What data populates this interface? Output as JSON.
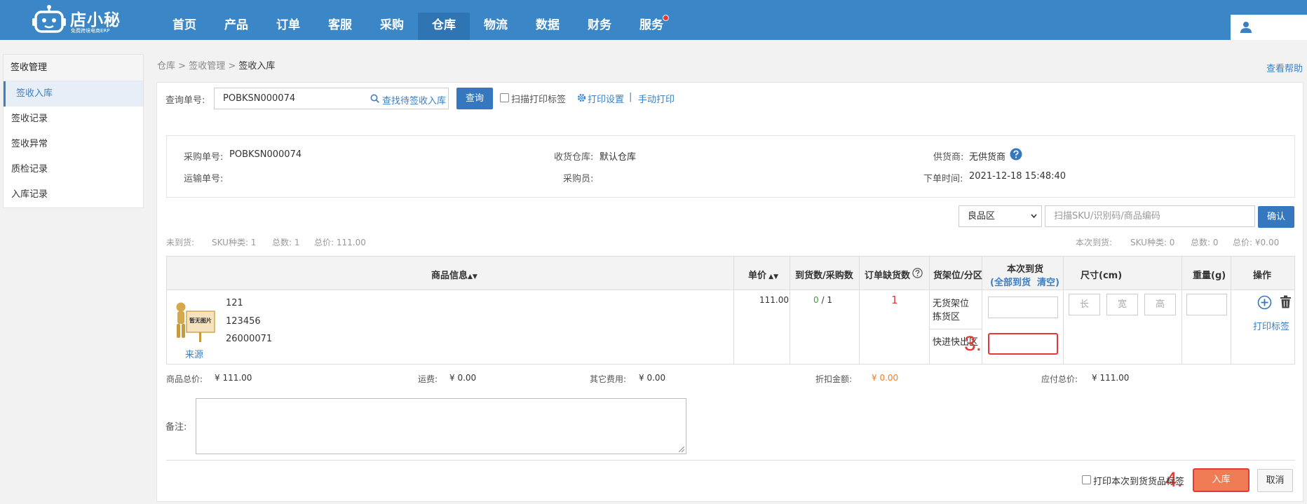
{
  "app": {
    "name": "店小秘",
    "subtitle": "免费跨境电商ERP"
  },
  "nav": [
    {
      "label": "首页"
    },
    {
      "label": "产品"
    },
    {
      "label": "订单"
    },
    {
      "label": "客服"
    },
    {
      "label": "采购"
    },
    {
      "label": "仓库"
    },
    {
      "label": "物流"
    },
    {
      "label": "数据"
    },
    {
      "label": "财务"
    },
    {
      "label": "服务"
    }
  ],
  "nav_active": "仓库",
  "sidebar": {
    "title": "签收管理",
    "items": [
      {
        "label": "签收入库"
      },
      {
        "label": "签收记录"
      },
      {
        "label": "签收异常"
      },
      {
        "label": "质检记录"
      },
      {
        "label": "入库记录"
      }
    ],
    "active": "签收入库"
  },
  "breadcrumb": {
    "p1": "仓库",
    "p2": "签收管理",
    "current": "签收入库",
    "sep": " > "
  },
  "help_link": "查看帮助",
  "query": {
    "label": "查询单号:",
    "value": "POBKSN000074",
    "find_link": "查找待签收入库",
    "search_button": "查询",
    "scan_print_label": "扫描打印标签",
    "print_settings": "打印设置",
    "divider": "|",
    "manual_print": "手动打印"
  },
  "order_info": {
    "po_label": "采购单号:",
    "po_value": "POBKSN000074",
    "warehouse_label": "收货仓库:",
    "warehouse_value": "默认仓库",
    "supplier_label": "供货商:",
    "supplier_value": "无供货商",
    "tracking_label": "运输单号:",
    "tracking_value": "",
    "buyer_label": "采购员:",
    "buyer_value": "",
    "order_time_label": "下单时间:",
    "order_time_value": "2021-12-18 15:48:40"
  },
  "zone_select": {
    "value": "良品区"
  },
  "scan": {
    "placeholder": "扫描SKU/识别码/商品编码",
    "confirm_button": "确认"
  },
  "summary_left": {
    "label": "未到货:",
    "sku": "SKU种类: 1",
    "total": "总数: 1",
    "price": "总价: 111.00"
  },
  "summary_right": {
    "label": "本次到货:",
    "sku": "SKU种类: 0",
    "total": "总数: 0",
    "price": "总价: ¥0.00"
  },
  "table": {
    "headers": {
      "product": "商品信息",
      "price": "单价",
      "arrived": "到货数/采购数",
      "shortage": "订单缺货数",
      "shelf": "货架位/分区",
      "current_arrival": "本次到货",
      "all_arrived": "全部到货",
      "clear": "清空",
      "size": "尺寸(cm)",
      "weight": "重量(g)",
      "action": "操作"
    },
    "row": {
      "no_image": "暂无图片",
      "source_link": "来源",
      "name": "121",
      "sku": "123456",
      "code": "26000071",
      "price": "111.00",
      "arrived": "0",
      "slash": " / ",
      "purchased": "1",
      "shortage": "1",
      "shelf1_line1": "无货架位",
      "shelf1_line2": "拣货区",
      "shelf2": "快进快出区",
      "len_ph": "长",
      "width_ph": "宽",
      "height_ph": "高",
      "print_label": "打印标签"
    }
  },
  "totals": {
    "goods_label": "商品总价:",
    "goods_value": "¥ 111.00",
    "freight_label": "运费:",
    "freight_value": "¥ 0.00",
    "other_label": "其它费用:",
    "other_value": "¥ 0.00",
    "discount_label": "折扣金额:",
    "discount_value": "¥ 0.00",
    "payable_label": "应付总价:",
    "payable_value": "¥ 111.00"
  },
  "remark_label": "备注:",
  "footer": {
    "print_check_label": "打印本次到货货品标签",
    "inbound_button": "入库",
    "cancel_button": "取消"
  },
  "annotations": {
    "step3": "3.",
    "step4": "4."
  },
  "colors": {
    "topbar": "#3b86c6",
    "primary": "#3578c0",
    "red_annotation": "#e53935",
    "inbound_button": "#f07c55"
  }
}
